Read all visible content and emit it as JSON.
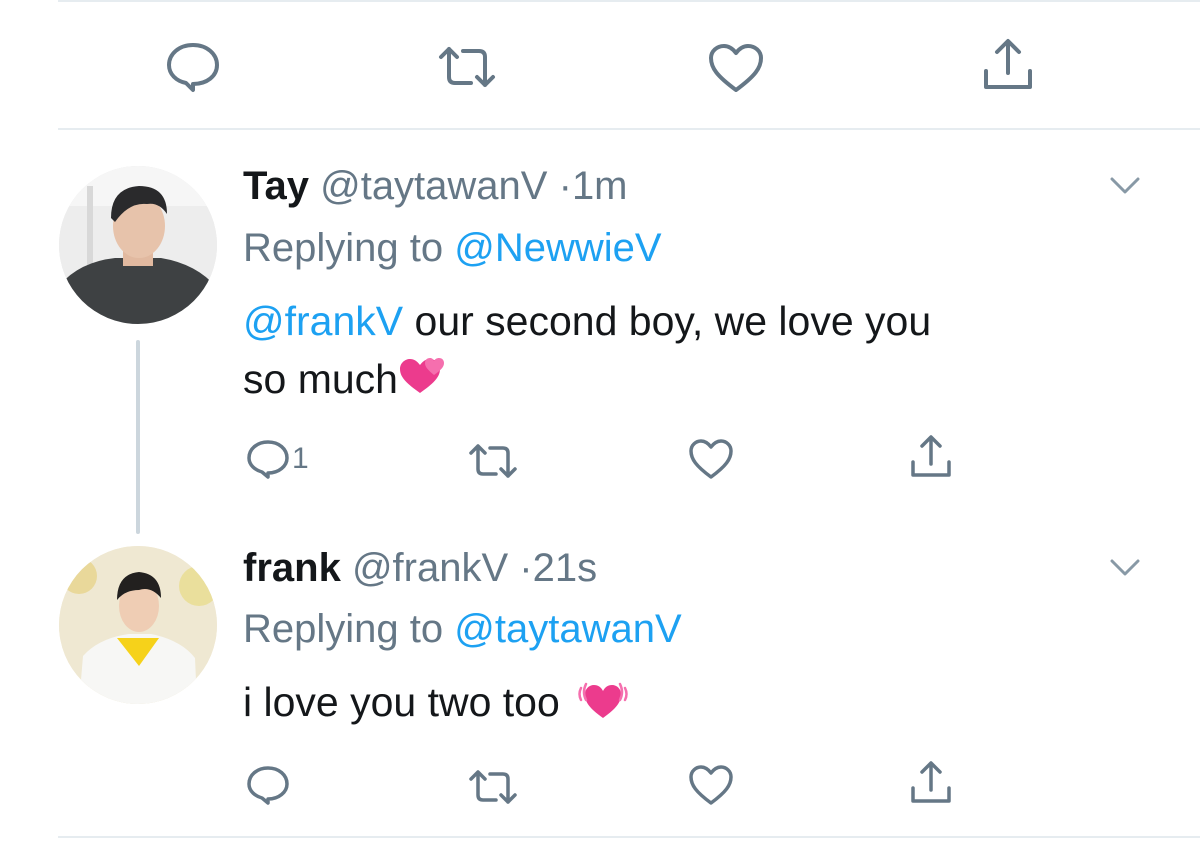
{
  "colors": {
    "accent": "#1da1f2",
    "secondary": "#657786",
    "divider": "#e6ecf0",
    "emoji_pink": "#ec3b8d"
  },
  "top_actions": {
    "icons": [
      "reply-icon",
      "retweet-icon",
      "like-icon",
      "share-icon"
    ]
  },
  "tweets": [
    {
      "name": "Tay",
      "handle": "@taytawanV",
      "separator": "·",
      "time": "1m",
      "replying_prefix": "Replying to",
      "replying_to": "@NewwieV",
      "mention": "@frankV",
      "text_rest": "our second boy, we love you",
      "text_line2": "so much",
      "emoji": "revolving-hearts-icon",
      "reply_count": "1"
    },
    {
      "name": "frank",
      "handle": "@frankV",
      "separator": "·",
      "time": "21s",
      "replying_prefix": "Replying to",
      "replying_to": "@taytawanV",
      "text": "i love you two too",
      "emoji": "beating-heart-icon",
      "reply_count": ""
    }
  ]
}
